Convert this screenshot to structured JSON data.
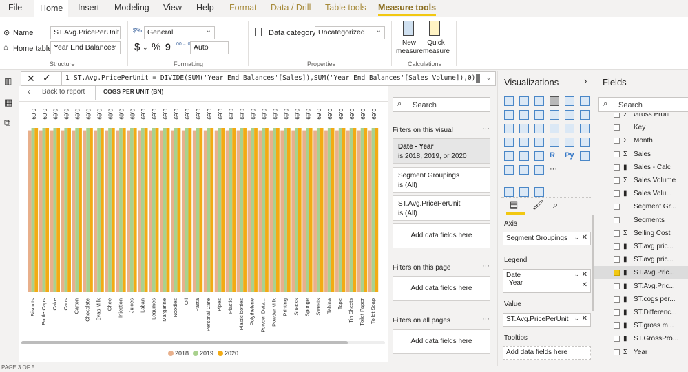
{
  "tabs": [
    "File",
    "Home",
    "Insert",
    "Modeling",
    "View",
    "Help",
    "Format",
    "Data / Drill",
    "Table tools",
    "Measure tools"
  ],
  "ribbon": {
    "name_label": "Name",
    "name_value": "ST.Avg.PricePerUnit",
    "home_table_label": "Home table",
    "home_table_value": "Year End Balances",
    "structure": "Structure",
    "format_value": "General",
    "currency": "$",
    "percent": "%",
    "comma": "9",
    "decimals": ".00→.0",
    "decimals_value": "Auto",
    "formatting": "Formatting",
    "data_category_label": "Data category",
    "data_category_value": "Uncategorized",
    "properties": "Properties",
    "new_measure": "New measure",
    "quick_measure": "Quick measure",
    "calculations": "Calculations"
  },
  "formula": {
    "line": "1",
    "text": "ST.Avg.PricePerUnit = DIVIDE(SUM('Year End Balances'[Sales]),SUM('Year End Balances'[Sales Volume]),0)"
  },
  "canvas": {
    "back": "Back to report",
    "title": "COGS PER UNIT (BN)"
  },
  "chart_data": {
    "type": "bar",
    "title": "COGS PER UNIT (BN)",
    "categories": [
      "Biscuits",
      "Bottle Caps",
      "Cake",
      "Cans",
      "Carton",
      "Chocolate",
      "Evap Milk",
      "Ghee",
      "Injection",
      "Juices",
      "Laban",
      "Legumes",
      "Margarine",
      "Noodles",
      "Oil",
      "Pasta",
      "Personal Care",
      "Pipes",
      "Plastic",
      "Plastic bottles",
      "Polythelene",
      "Powder Dete...",
      "Powder Milk",
      "Printing",
      "Snacks",
      "Sponge",
      "Sweets",
      "Tahina",
      "Tape",
      "Tin Sheets",
      "Toilet Paper",
      "Toilet Soap"
    ],
    "series": [
      {
        "name": "2018",
        "color": "#e8b08c",
        "values": [
          0.69,
          0.69,
          0.69,
          0.69,
          0.69,
          0.69,
          0.69,
          0.69,
          0.69,
          0.69,
          0.69,
          0.69,
          0.69,
          0.69,
          0.69,
          0.69,
          0.69,
          0.69,
          0.69,
          0.69,
          0.69,
          0.69,
          0.69,
          0.69,
          0.69,
          0.69,
          0.69,
          0.69,
          0.69,
          0.69,
          0.69,
          0.69
        ]
      },
      {
        "name": "2019",
        "color": "#a9d18e",
        "values": [
          0.69,
          0.69,
          0.69,
          0.69,
          0.69,
          0.69,
          0.69,
          0.69,
          0.69,
          0.69,
          0.69,
          0.69,
          0.69,
          0.69,
          0.69,
          0.69,
          0.69,
          0.69,
          0.69,
          0.69,
          0.69,
          0.69,
          0.69,
          0.69,
          0.69,
          0.69,
          0.69,
          0.69,
          0.69,
          0.69,
          0.69,
          0.69
        ]
      },
      {
        "name": "2020",
        "color": "#f2ab14",
        "values": [
          0.69,
          0.69,
          0.69,
          0.69,
          0.69,
          0.69,
          0.69,
          0.69,
          0.69,
          0.69,
          0.69,
          0.69,
          0.69,
          0.69,
          0.69,
          0.69,
          0.69,
          0.69,
          0.69,
          0.69,
          0.69,
          0.69,
          0.69,
          0.69,
          0.69,
          0.69,
          0.69,
          0.69,
          0.69,
          0.69,
          0.69,
          0.69
        ]
      }
    ],
    "data_label": "0.69",
    "legend_position": "bottom",
    "grid": false
  },
  "filters": {
    "search": "Search",
    "on_visual": "Filters on this visual",
    "cards": [
      {
        "title": "Date - Year",
        "sub": "is 2018, 2019, or 2020"
      },
      {
        "title": "Segment Groupings",
        "sub": "is (All)"
      },
      {
        "title": "ST.Avg.PricePerUnit",
        "sub": "is (All)"
      }
    ],
    "add": "Add data fields here",
    "on_page": "Filters on this page",
    "on_all": "Filters on all pages"
  },
  "viz": {
    "title": "Visualizations",
    "icons": [
      "stacked-bar",
      "stacked-column",
      "clustered-bar",
      "clustered-column",
      "100-bar",
      "100-column",
      "line",
      "area",
      "stacked-area",
      "line-column",
      "line-clustered",
      "ribbon",
      "waterfall",
      "funnel",
      "scatter",
      "pie",
      "donut",
      "treemap",
      "map",
      "filled-map",
      "gauge",
      "card",
      "multi-row-card",
      "kpi",
      "slicer",
      "table",
      "matrix",
      "r-visual",
      "python-visual",
      "key-influencers",
      "qa",
      "decomposition",
      "paginated",
      "more",
      "custom-1",
      "custom-2",
      "custom-3"
    ],
    "axis": "Axis",
    "axis_field": "Segment Groupings",
    "legend": "Legend",
    "legend_field": "Date",
    "legend_sub": "Year",
    "value": "Value",
    "value_field": "ST.Avg.PricePerUnit",
    "tooltips": "Tooltips",
    "tooltips_add": "Add data fields here"
  },
  "fields": {
    "title": "Fields",
    "search": "Search",
    "items": [
      {
        "label": "Gross Profit",
        "type": "sigma",
        "checked": false
      },
      {
        "label": "Key",
        "type": "none",
        "checked": false
      },
      {
        "label": "Month",
        "type": "sigma",
        "checked": false
      },
      {
        "label": "Sales",
        "type": "sigma",
        "checked": false
      },
      {
        "label": "Sales - Calc",
        "type": "calc",
        "checked": false
      },
      {
        "label": "Sales Volume",
        "type": "sigma",
        "checked": false
      },
      {
        "label": "Sales Volu...",
        "type": "calc",
        "checked": false
      },
      {
        "label": "Segment Gr...",
        "type": "none",
        "checked": false
      },
      {
        "label": "Segments",
        "type": "none",
        "checked": false
      },
      {
        "label": "Selling Cost",
        "type": "sigma",
        "checked": false
      },
      {
        "label": "ST.avg pric...",
        "type": "calc",
        "checked": false
      },
      {
        "label": "ST.avg pric...",
        "type": "calc",
        "checked": false
      },
      {
        "label": "ST.Avg.Pric...",
        "type": "calc",
        "checked": true
      },
      {
        "label": "ST.Avg.Pric...",
        "type": "calc",
        "checked": false
      },
      {
        "label": "ST.cogs per...",
        "type": "calc",
        "checked": false
      },
      {
        "label": "ST.Differenc...",
        "type": "calc",
        "checked": false
      },
      {
        "label": "ST.gross m...",
        "type": "calc",
        "checked": false
      },
      {
        "label": "ST.GrossPro...",
        "type": "calc",
        "checked": false
      },
      {
        "label": "Year",
        "type": "sigma",
        "checked": false
      }
    ]
  },
  "status": "PAGE 3 OF 5"
}
